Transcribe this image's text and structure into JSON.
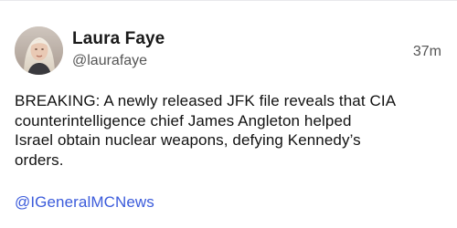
{
  "post": {
    "author": {
      "display_name": "Laura Faye",
      "handle": "@laurafaye",
      "avatar_icon": "avatar-photo-icon"
    },
    "timestamp": "37m",
    "body_lines": [
      "BREAKING: A newly released JFK file reveals that CIA",
      "counterintelligence chief James Angleton helped",
      "Israel obtain nuclear weapons, defying Kennedy’s",
      "orders."
    ],
    "mention": "@IGeneralMCNews"
  },
  "colors": {
    "background": "#ffffff",
    "text_primary": "#111111",
    "text_secondary": "#555555",
    "mention_link": "#3b5bdb",
    "divider": "#e8e8ec"
  }
}
